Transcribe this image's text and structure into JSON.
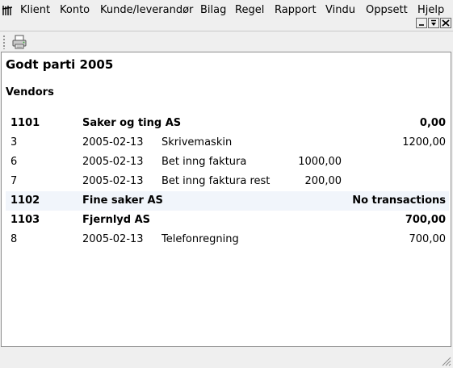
{
  "menubar": {
    "items": [
      "Klient",
      "Konto",
      "Kunde/leverandør",
      "Bilag",
      "Regel",
      "Rapport",
      "Vindu",
      "Oppsett",
      "Hjelp"
    ]
  },
  "report": {
    "title": "Godt parti 2005",
    "subtitle": "Vendors",
    "rows": [
      {
        "kind": "vendor",
        "id": "1101",
        "name": "Saker og ting AS",
        "balance": "0,00"
      },
      {
        "kind": "tx",
        "no": "3",
        "date": "2005-02-13",
        "text": "Skrivemaskin",
        "amount": "",
        "balance": "1200,00"
      },
      {
        "kind": "tx",
        "no": "6",
        "date": "2005-02-13",
        "text": "Bet inng faktura",
        "amount": "1000,00",
        "balance": ""
      },
      {
        "kind": "tx",
        "no": "7",
        "date": "2005-02-13",
        "text": "Bet inng faktura rest",
        "amount": "200,00",
        "balance": ""
      },
      {
        "kind": "vendor",
        "id": "1102",
        "name": "Fine saker AS",
        "balance": "No transactions"
      },
      {
        "kind": "vendor",
        "id": "1103",
        "name": "Fjernlyd AS",
        "balance": "700,00"
      },
      {
        "kind": "tx",
        "no": "8",
        "date": "2005-02-13",
        "text": "Telefonregning",
        "amount": "",
        "balance": "700,00"
      }
    ]
  },
  "icons": {
    "app": "app-menu-icon",
    "print": "print-icon",
    "minimize": "minimize-icon",
    "restore": "restore-icon",
    "close": "close-icon",
    "size_grip": "resize-grip-icon"
  }
}
